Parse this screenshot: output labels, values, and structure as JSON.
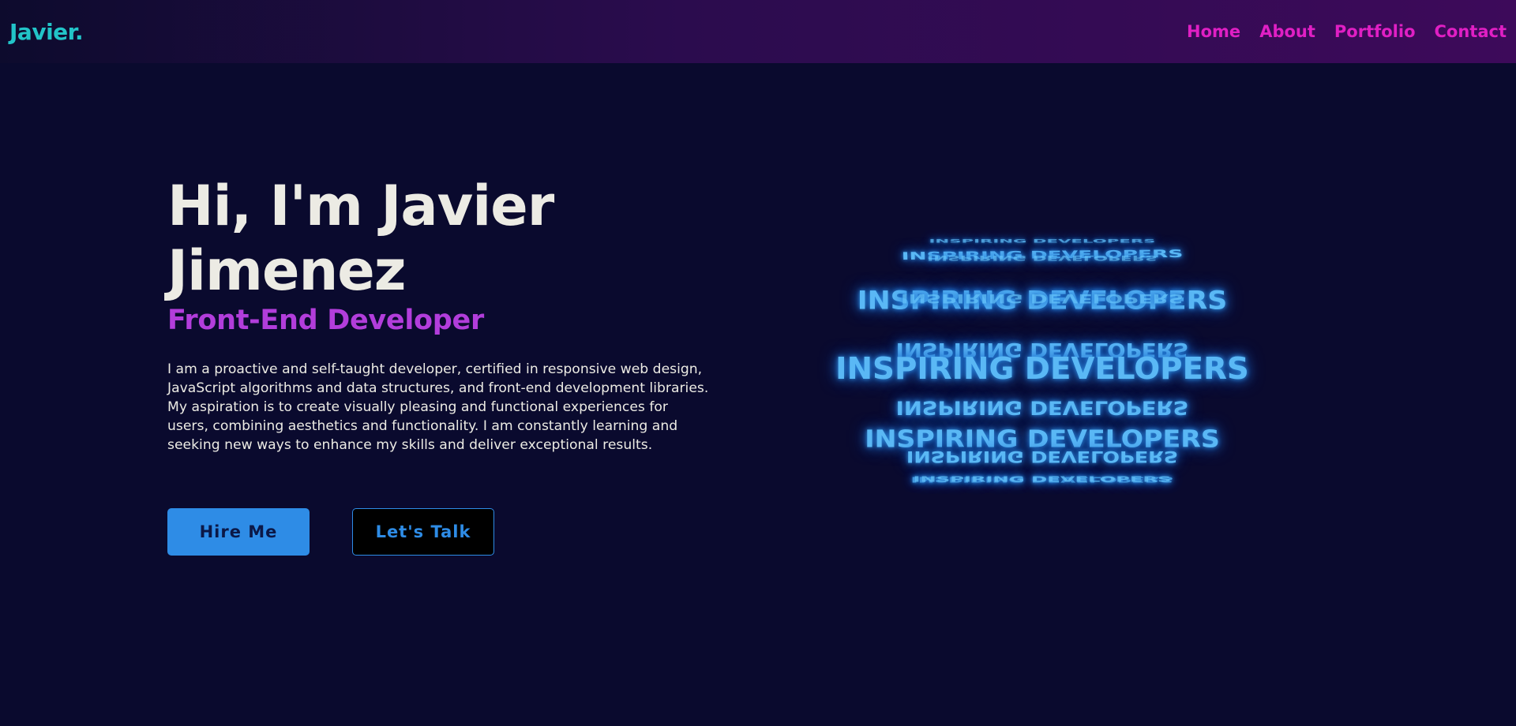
{
  "navbar": {
    "logo": "Javier.",
    "links": [
      "Home",
      "About",
      "Portfolio",
      "Contact"
    ]
  },
  "hero": {
    "title_line1": "Hi, I'm Javier",
    "title_line2": "Jimenez",
    "subtitle": "Front-End Developer",
    "description": "I am a proactive and self-taught developer, certified in responsive web design, JavaScript algorithms and data structures, and front-end development libraries. My aspiration is to create visually pleasing and functional experiences for users, combining aesthetics and functionality. I am constantly learning and seeking new ways to enhance my skills and deliver exceptional results.",
    "buttons": {
      "primary": "Hire Me",
      "secondary": "Let's Talk"
    }
  },
  "rings": {
    "text": "INSPIRING DEVELOPERS"
  },
  "colors": {
    "background": "#0a0a2e",
    "logo": "#22c4c8",
    "nav_link": "#e01fc4",
    "subtitle": "#b23ddb",
    "accent_blue": "#2e8ce6",
    "ring_text": "#5ab8f5"
  }
}
